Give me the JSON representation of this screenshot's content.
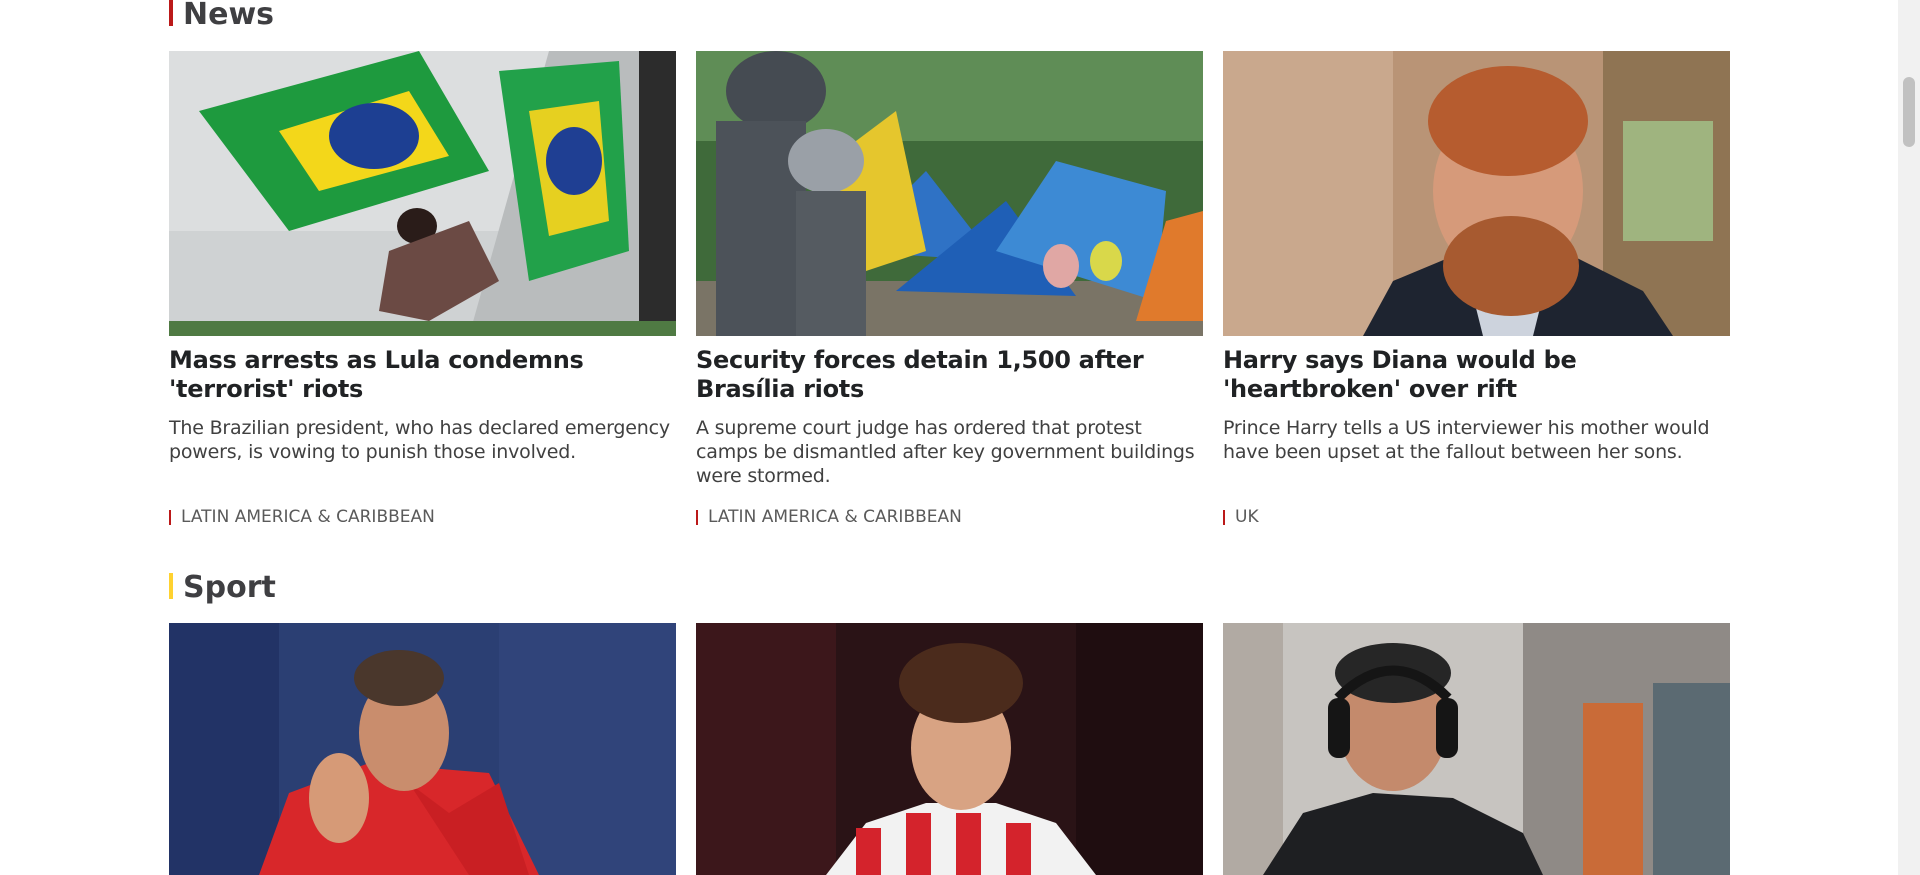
{
  "sections": {
    "news": {
      "title": "News",
      "cards": [
        {
          "headline": "Mass arrests as Lula condemns 'terrorist' riots",
          "summary": "The Brazilian president, who has declared emergency powers, is vowing to punish those involved.",
          "tag": "LATIN AMERICA & CARIBBEAN"
        },
        {
          "headline": "Security forces detain 1,500 after Brasília riots",
          "summary": "A supreme court judge has ordered that protest camps be dismantled after key government buildings were stormed.",
          "tag": "LATIN AMERICA & CARIBBEAN"
        },
        {
          "headline": "Harry says Diana would be 'heartbroken' over rift",
          "summary": "Prince Harry tells a US interviewer his mother would have been upset at the fallout between her sons.",
          "tag": "UK"
        }
      ]
    },
    "sport": {
      "title": "Sport"
    }
  },
  "colors": {
    "news_accent": "#bb1919",
    "sport_accent": "#ffd230"
  }
}
